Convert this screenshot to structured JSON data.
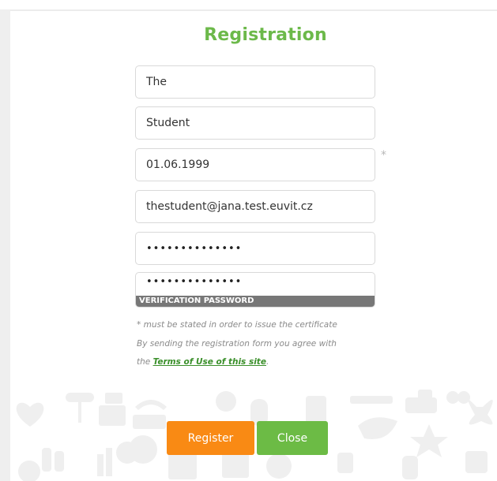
{
  "form": {
    "title": "Registration",
    "first_name": "The",
    "last_name": "Student",
    "birth_date": "01.06.1999",
    "email": "thestudent@jana.test.euvit.cz",
    "password_mask": "••••••••••••••",
    "verify_password_mask": "••••••••••••••",
    "verify_password_label": "VERIFICATION PASSWORD",
    "required_mark": "*",
    "note_required": "* must be stated in order to issue the certificate",
    "note_agree": "By sending the registration form you agree with",
    "note_the": "the ",
    "terms_link": "Terms of Use of this site",
    "note_end": ".",
    "register_label": "Register",
    "close_label": "Close"
  },
  "colors": {
    "accent_green": "#6cb94a",
    "register_orange": "#f98a14",
    "close_green": "#6cbb45",
    "label_gray": "#777777"
  }
}
